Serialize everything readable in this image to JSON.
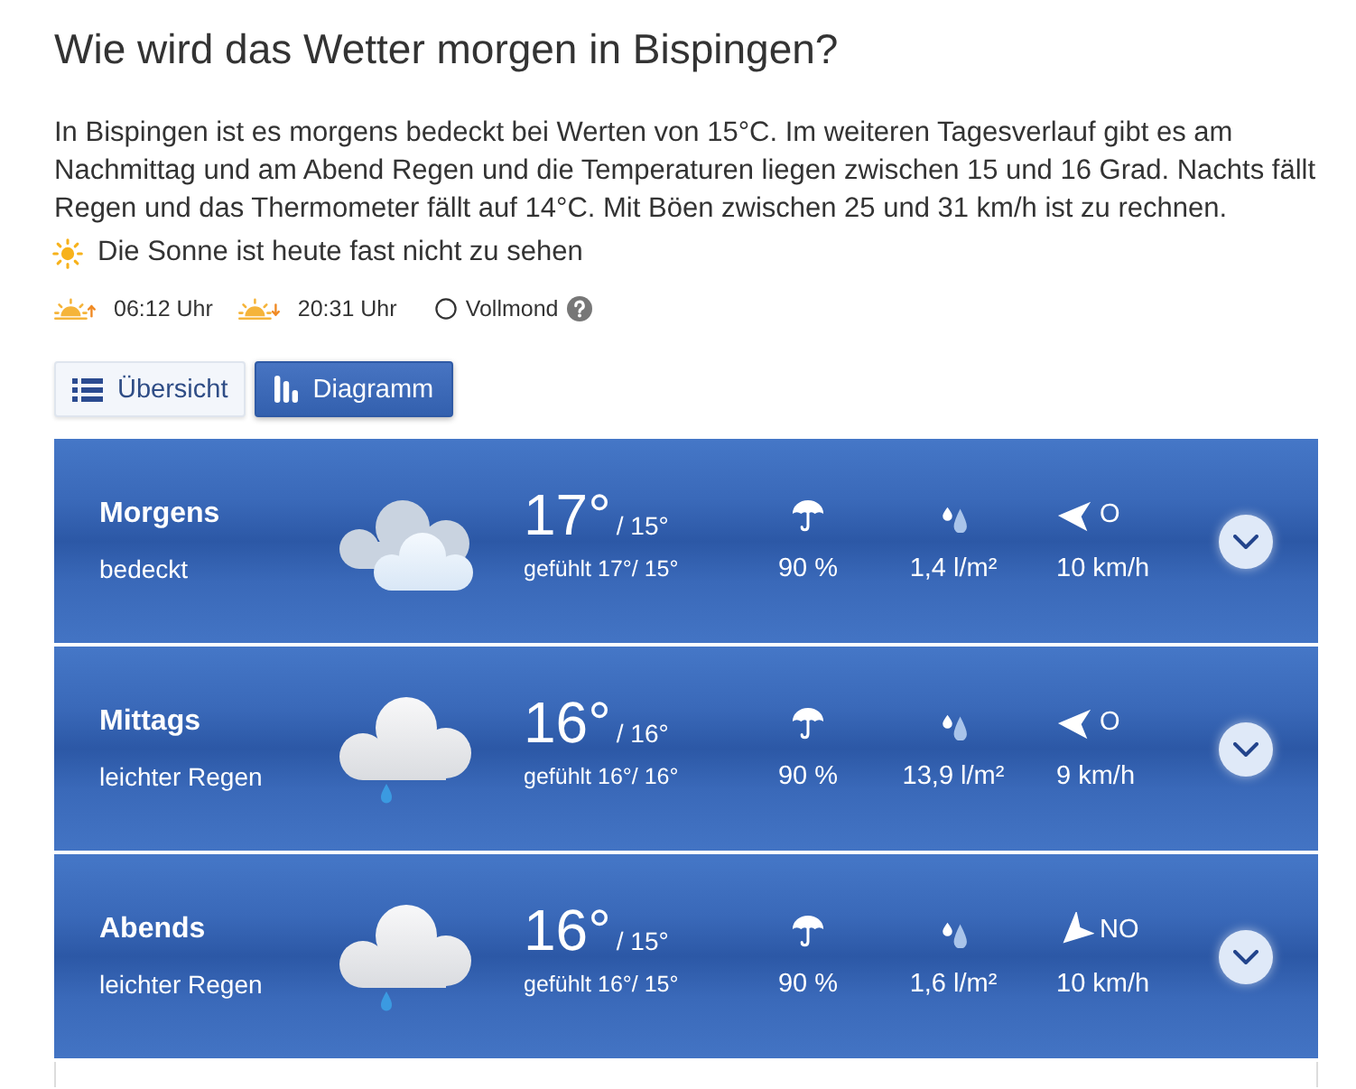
{
  "title": "Wie wird das Wetter morgen in Bispingen?",
  "summary": "In Bispingen ist es morgens bedeckt bei Werten von 15°C. Im weiteren Tagesverlauf gibt es am Nachmittag und am Abend Regen und die Temperaturen liegen zwischen 15 und 16 Grad. Nachts fällt Regen und das Thermometer fällt auf 14°C. Mit Böen zwischen 25 und 31 km/h ist zu rechnen.",
  "sunshine": "Die Sonne ist heute fast nicht zu sehen",
  "sun_times": {
    "sunrise": "06:12 Uhr",
    "sunset": "20:31 Uhr",
    "moon": "Vollmond"
  },
  "view_tabs": [
    {
      "label": "Übersicht",
      "kind": "list",
      "selected": false
    },
    {
      "label": "Diagramm",
      "kind": "chart",
      "selected": true
    }
  ],
  "periods": [
    {
      "kind": "overcast",
      "name": "Morgens",
      "description": "bedeckt",
      "temperature": "17°",
      "low": "/ 15°",
      "feels_like": "gefühlt 17°/ 15°",
      "rain_chance": "90 %",
      "precipitation": "1,4 l/m²",
      "wind": {
        "kind": "west",
        "direction": "O",
        "speed": "10 km/h"
      },
      "expanded": false
    },
    {
      "kind": "rain",
      "name": "Mittags",
      "description": "leichter Regen",
      "temperature": "16°",
      "low": "/ 16°",
      "feels_like": "gefühlt 16°/ 16°",
      "rain_chance": "90 %",
      "precipitation": "13,9 l/m²",
      "wind": {
        "kind": "west",
        "direction": "O",
        "speed": "9 km/h"
      },
      "expanded": false
    },
    {
      "kind": "rain",
      "name": "Abends",
      "description": "leichter Regen",
      "temperature": "16°",
      "low": "/ 15°",
      "feels_like": "gefühlt 16°/ 15°",
      "rain_chance": "90 %",
      "precipitation": "1,6 l/m²",
      "wind": {
        "kind": "southwest",
        "direction": "NO",
        "speed": "10 km/h"
      },
      "expanded": false
    }
  ]
}
